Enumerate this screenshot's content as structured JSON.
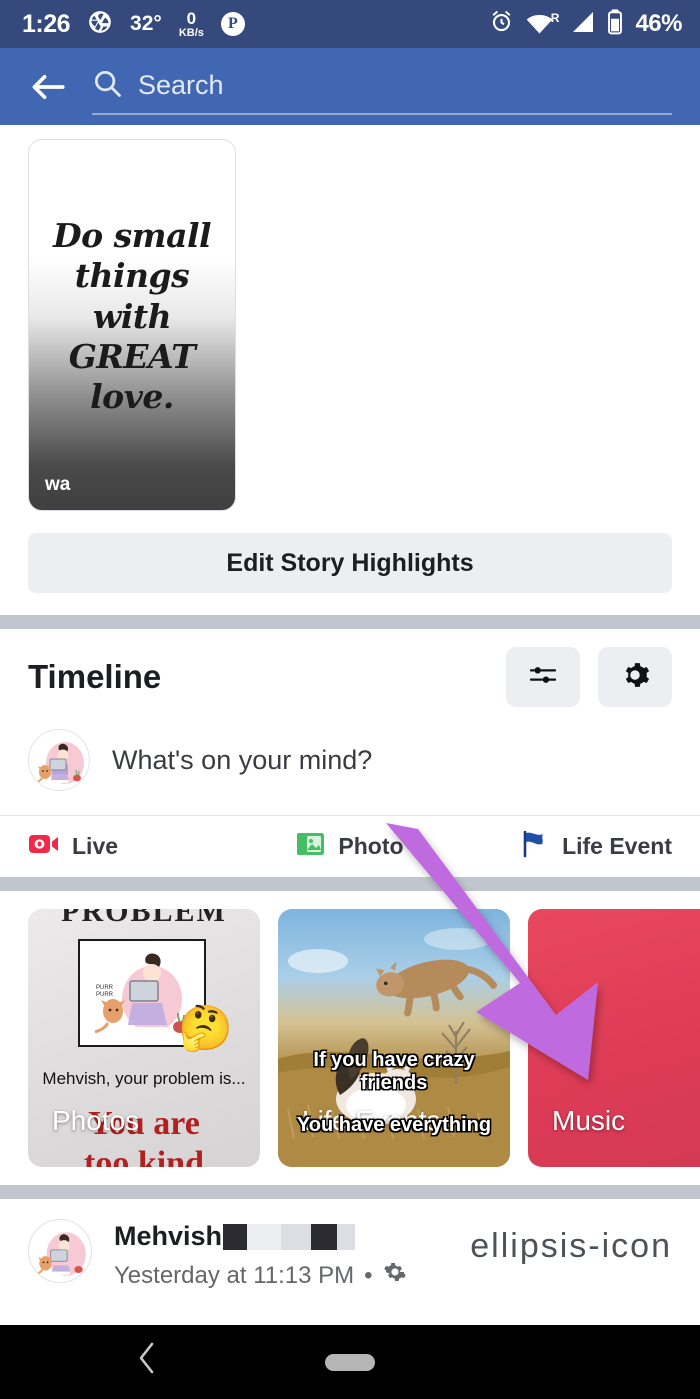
{
  "status_bar": {
    "time": "1:26",
    "camera_icon": "aperture-icon",
    "temperature": "32°",
    "data_rate_value": "0",
    "data_rate_unit": "KB/s",
    "parking_badge": "P",
    "alarm_icon": "alarm-clock-icon",
    "wifi_icon": "wifi-icon",
    "roaming": "R",
    "signal_icon": "signal-bars-icon",
    "battery_icon": "battery-icon",
    "battery_percent": "46%",
    "background": "#35497c"
  },
  "app_bar": {
    "back_icon": "back-arrow-icon",
    "search_icon": "search-icon",
    "search_placeholder": "Search",
    "background": "#4267b2"
  },
  "story_highlights": {
    "card": {
      "quote_line1": "Do small",
      "quote_line2": "things with",
      "quote_line3": "GREAT love.",
      "watermark": "wa"
    },
    "edit_button_label": "Edit Story Highlights"
  },
  "timeline": {
    "title": "Timeline",
    "filter_icon": "sliders-icon",
    "settings_icon": "gear-icon",
    "composer": {
      "avatar_icon": "avatar",
      "placeholder": "What's on your mind?"
    },
    "actions": [
      {
        "label": "Live",
        "icon": "live-video-icon",
        "color": "#f02849"
      },
      {
        "label": "Photo",
        "icon": "photo-icon",
        "color": "#45bd62"
      },
      {
        "label": "Life Event",
        "icon": "flag-icon",
        "color": "#1b74e4"
      }
    ]
  },
  "cards": [
    {
      "label": "Photos",
      "type": "photos",
      "overlay_top_text": "PROBLEM",
      "overlay_caption": "Mehvish, your problem is...",
      "overlay_red_line1": "You are",
      "overlay_red_line2": "too kind",
      "thumb_icon": "thinking-face-emoji"
    },
    {
      "label": "Life Events",
      "type": "life-events",
      "meme_line1": "If you have crazy friends",
      "meme_line2": "You have everything"
    },
    {
      "label": "Music",
      "type": "music",
      "color": "#e0455e"
    }
  ],
  "post": {
    "author": "Mehvish",
    "author_redacted": true,
    "timestamp": "Yesterday at 11:13 PM",
    "meta_separator": "•",
    "audience_icon": "gear-icon",
    "more_icon": "ellipsis-icon"
  },
  "nav_bar": {
    "back_icon": "chevron-left-icon",
    "home_pill_icon": "gesture-pill"
  },
  "annotation": {
    "arrow_icon": "arrow-pointer",
    "color": "#c06ae0",
    "points_to": "Music"
  }
}
